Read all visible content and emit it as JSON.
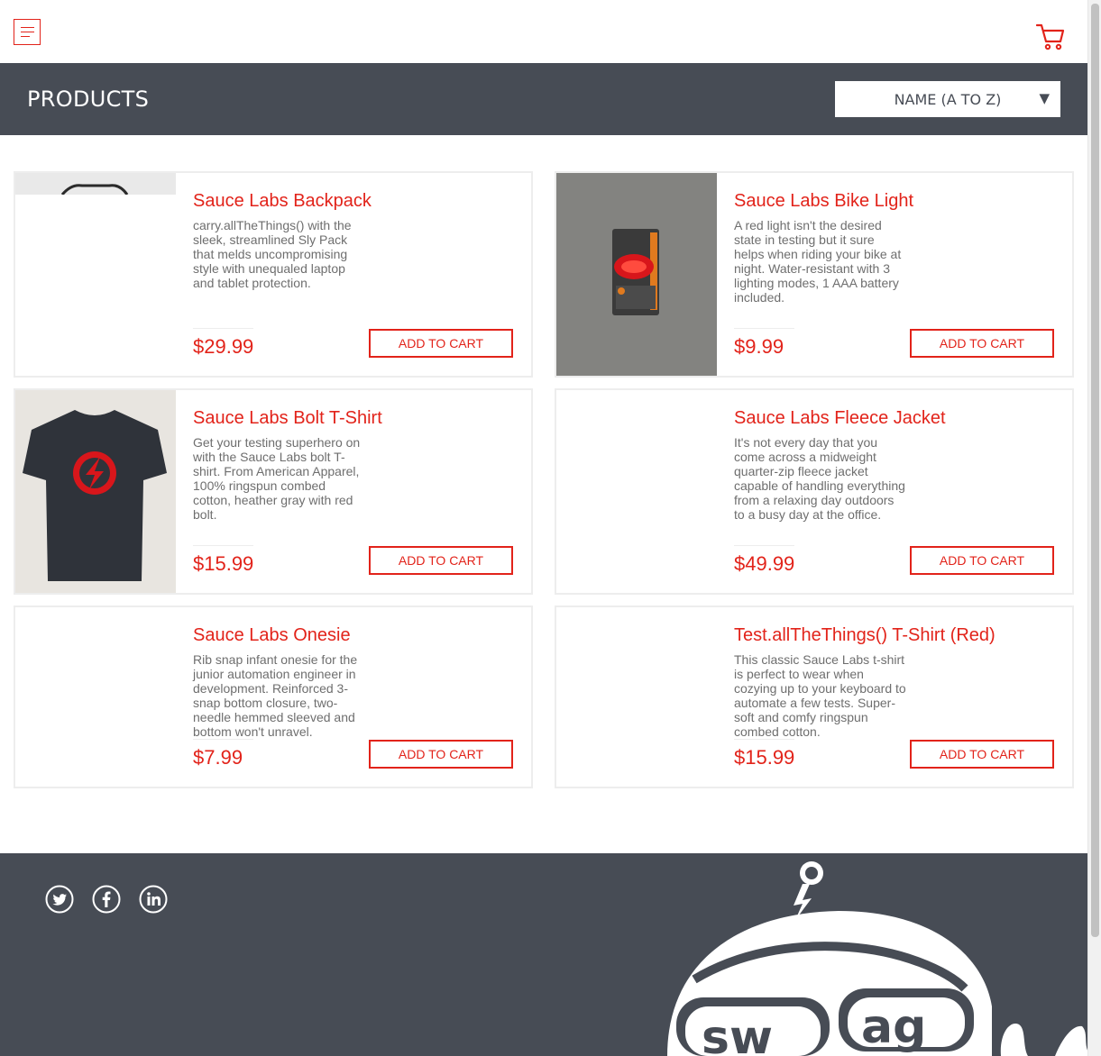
{
  "header": {
    "menu_icon": "menu-icon",
    "cart_icon": "cart-icon"
  },
  "subheader": {
    "title": "PRODUCTS",
    "sort_selected": "NAME (A TO Z)",
    "sort_arrow": "▼"
  },
  "products": [
    {
      "name": "Sauce Labs Backpack",
      "description": "carry.allTheThings() with the sleek, streamlined Sly Pack that melds uncompromising style with unequaled laptop and tablet protection.",
      "price": "$29.99",
      "button": "ADD TO CART"
    },
    {
      "name": "Sauce Labs Bike Light",
      "description": "A red light isn't the desired state in testing but it sure helps when riding your bike at night. Water-resistant with 3 lighting modes, 1 AAA battery included.",
      "price": "$9.99",
      "button": "ADD TO CART"
    },
    {
      "name": "Sauce Labs Bolt T-Shirt",
      "description": "Get your testing superhero on with the Sauce Labs bolt T-shirt. From American Apparel, 100% ringspun combed cotton, heather gray with red bolt.",
      "price": "$15.99",
      "button": "ADD TO CART"
    },
    {
      "name": "Sauce Labs Fleece Jacket",
      "description": "It's not every day that you come across a midweight quarter-zip fleece jacket capable of handling everything from a relaxing day outdoors to a busy day at the office.",
      "price": "$49.99",
      "button": "ADD TO CART"
    },
    {
      "name": "Sauce Labs Onesie",
      "description": "Rib snap infant onesie for the junior automation engineer in development. Reinforced 3-snap bottom closure, two-needle hemmed sleeved and bottom won't unravel.",
      "price": "$7.99",
      "button": "ADD TO CART"
    },
    {
      "name": "Test.allTheThings() T-Shirt (Red)",
      "description": "This classic Sauce Labs t-shirt is perfect to wear when cozying up to your keyboard to automate a few tests. Super-soft and comfy ringspun combed cotton.",
      "price": "$15.99",
      "button": "ADD TO CART"
    }
  ],
  "footer": {
    "social": [
      "twitter-icon",
      "facebook-icon",
      "linkedin-icon"
    ],
    "logo_text": "swag"
  },
  "colors": {
    "accent": "#e2231a",
    "dark": "#474c55",
    "border": "#ededed",
    "text": "#6e6e6e"
  }
}
